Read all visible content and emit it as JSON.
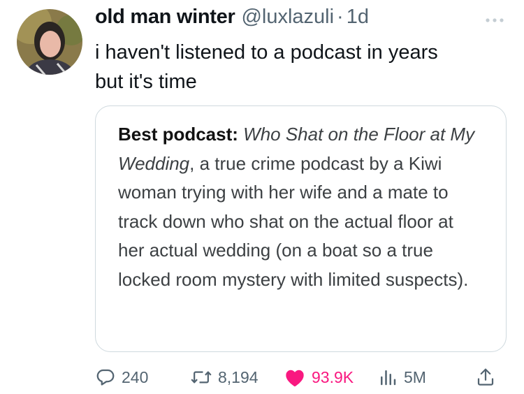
{
  "tweet": {
    "display_name": "old man winter",
    "handle": "@luxlazuli",
    "separator": "·",
    "time": "1d",
    "text": "i haven't listened to a podcast in years\nbut it's time"
  },
  "quote": {
    "lead": "Best podcast:",
    "title": "Who Shat on the Floor at My Wedding",
    "body": ", a true crime podcast by a Kiwi woman trying with her wife and a mate to track down who shat on the actual floor at her actual wedding (on a boat so a true locked room mystery with limited suspects)."
  },
  "actions": {
    "replies": "240",
    "retweets": "8,194",
    "likes": "93.9K",
    "views": "5M"
  },
  "icons": {
    "more": "more-dots-icon",
    "reply": "reply-bubble-icon",
    "retweet": "retweet-icon",
    "like": "heart-filled-icon",
    "views": "bar-chart-icon",
    "share": "share-upload-icon"
  },
  "colors": {
    "text": "#0f1419",
    "muted": "#536471",
    "like": "#f91880",
    "border": "#cfd9de"
  }
}
